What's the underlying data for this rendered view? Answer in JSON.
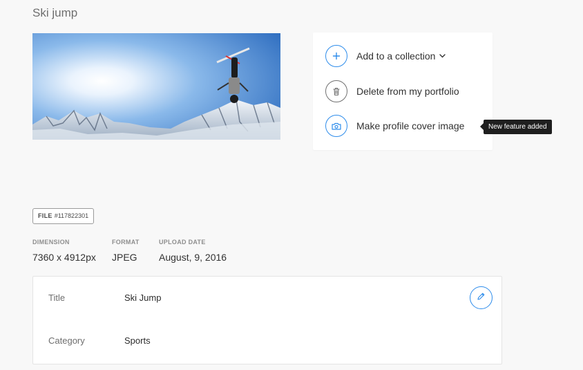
{
  "page": {
    "title": "Ski jump"
  },
  "image": {
    "subject": "skier-photo"
  },
  "actions": [
    {
      "label": "Add to a collection",
      "icon": "plus-icon",
      "has_dropdown": true
    },
    {
      "label": "Delete from my portfolio",
      "icon": "trash-icon"
    },
    {
      "label": "Make profile cover image",
      "icon": "camera-icon"
    }
  ],
  "tooltip": {
    "text": "New feature added"
  },
  "file": {
    "key": "FILE",
    "id": "#117822301"
  },
  "meta": {
    "dimension": {
      "label": "DIMENSION",
      "value": "7360 x 4912px"
    },
    "format": {
      "label": "FORMAT",
      "value": "JPEG"
    },
    "upload_date": {
      "label": "UPLOAD DATE",
      "value": "August, 9, 2016"
    }
  },
  "details": {
    "rows": [
      {
        "key": "Title",
        "value": "Ski Jump"
      },
      {
        "key": "Category",
        "value": "Sports"
      }
    ],
    "edit_icon": "pencil-icon"
  },
  "colors": {
    "accent": "#2d8ceb",
    "tooltip_bg": "#1f1f1f",
    "page_bg": "#f8f8f8"
  }
}
